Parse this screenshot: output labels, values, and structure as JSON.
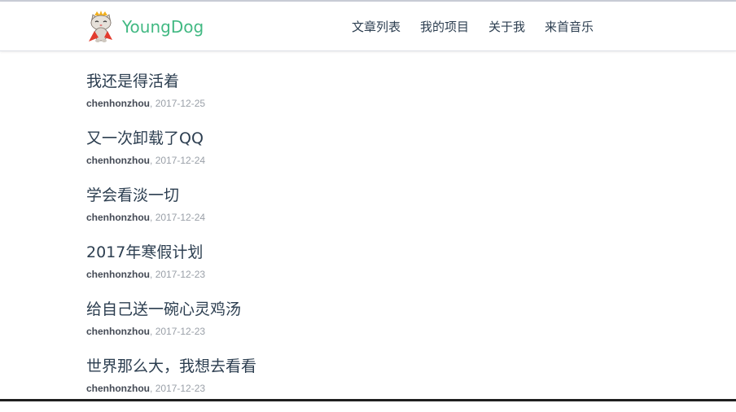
{
  "header": {
    "brand": "YoungDog",
    "nav": [
      {
        "label": "文章列表"
      },
      {
        "label": "我的项目"
      },
      {
        "label": "关于我"
      },
      {
        "label": "来首音乐"
      }
    ]
  },
  "posts": [
    {
      "title": "我还是得活着",
      "author": "chenhonzhou",
      "separator": ",",
      "date": "2017-12-25"
    },
    {
      "title": "又一次卸载了QQ",
      "author": "chenhonzhou",
      "separator": ",",
      "date": "2017-12-24"
    },
    {
      "title": "学会看淡一切",
      "author": "chenhonzhou",
      "separator": ",",
      "date": "2017-12-24"
    },
    {
      "title": "2017年寒假计划",
      "author": "chenhonzhou",
      "separator": ",",
      "date": "2017-12-23"
    },
    {
      "title": "给自己送一碗心灵鸡汤",
      "author": "chenhonzhou",
      "separator": ",",
      "date": "2017-12-23"
    },
    {
      "title": "世界那么大，我想去看看",
      "author": "chenhonzhou",
      "separator": ",",
      "date": "2017-12-23"
    }
  ],
  "colors": {
    "brand": "#42b983",
    "text": "#2c3e50",
    "muted": "#9aa0a8"
  },
  "icons": {
    "logo": "cat-mascot-logo-icon"
  }
}
